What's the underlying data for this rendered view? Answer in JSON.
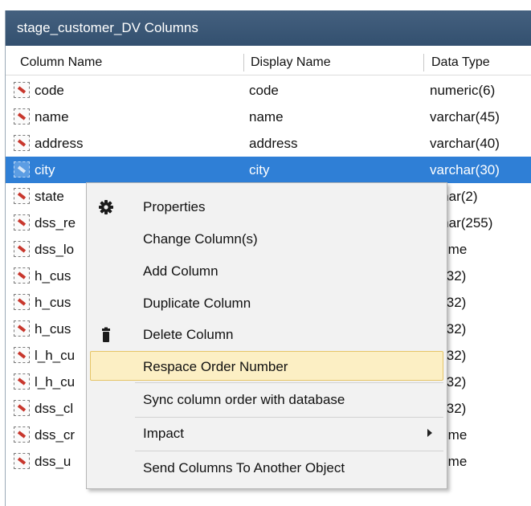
{
  "window": {
    "title": "stage_customer_DV Columns"
  },
  "columns": {
    "name": "Column Name",
    "display": "Display Name",
    "type": "Data Type"
  },
  "rows": [
    {
      "name": "code",
      "display": "code",
      "type": "numeric(6)"
    },
    {
      "name": "name",
      "display": "name",
      "type": "varchar(45)"
    },
    {
      "name": "address",
      "display": "address",
      "type": "varchar(40)"
    },
    {
      "name": "city",
      "display": "city",
      "type": "varchar(30)",
      "selected": true
    },
    {
      "name": "state",
      "display": "",
      "type": "rchar(2)"
    },
    {
      "name": "dss_re",
      "display": "",
      "type": "rchar(255)"
    },
    {
      "name": "dss_lo",
      "display": "",
      "type": "tetime"
    },
    {
      "name": "h_cus",
      "display": "",
      "type": "ar(32)"
    },
    {
      "name": "h_cus",
      "display": "",
      "type": "ar(32)"
    },
    {
      "name": "h_cus",
      "display": "",
      "type": "ar(32)"
    },
    {
      "name": "l_h_cu",
      "display": "",
      "type": "ar(32)"
    },
    {
      "name": "l_h_cu",
      "display": "",
      "type": "ar(32)"
    },
    {
      "name": "dss_cl",
      "display": "",
      "type": "ar(32)"
    },
    {
      "name": "dss_cr",
      "display": "",
      "type": "tetime"
    },
    {
      "name": "dss_u",
      "display": "",
      "type": "tetime"
    }
  ],
  "context_menu": {
    "items": [
      {
        "label": "Properties",
        "icon": "gear-icon"
      },
      {
        "label": "Change Column(s)"
      },
      {
        "label": "Add Column"
      },
      {
        "label": "Duplicate Column"
      },
      {
        "label": "Delete Column",
        "icon": "trash-icon"
      },
      {
        "label": "Respace Order Number",
        "highlighted": true
      },
      {
        "label": "Sync column order with database"
      },
      {
        "label": "Impact",
        "submenu": true
      },
      {
        "label": "Send Columns To Another Object"
      }
    ]
  },
  "colors": {
    "title_bar": "#3b5878",
    "selection": "#2f7fd6",
    "menu_highlight": "#fcefc4"
  }
}
